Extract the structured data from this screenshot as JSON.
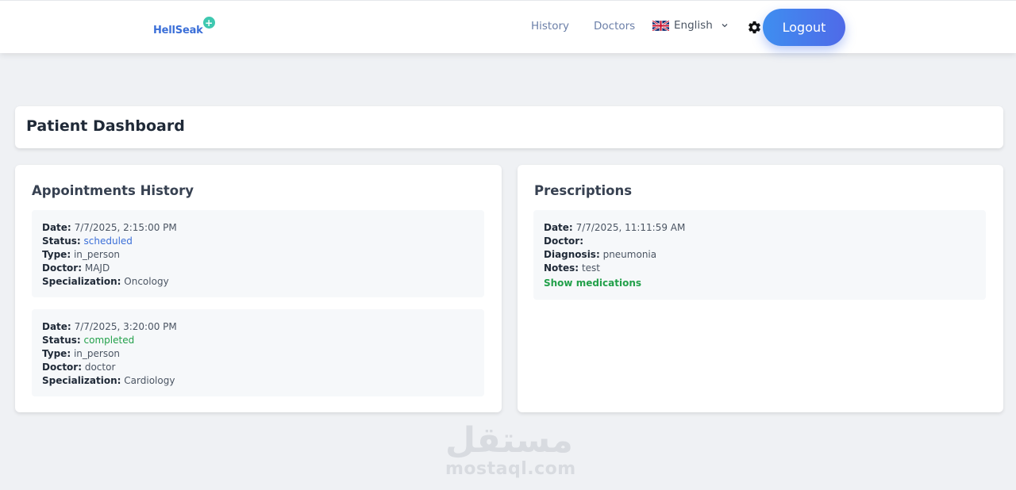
{
  "brand": {
    "name": "HellSeak",
    "plus": "+"
  },
  "nav": {
    "history": "History",
    "doctors": "Doctors",
    "language": "English",
    "logout": "Logout"
  },
  "page": {
    "title": "Patient Dashboard"
  },
  "appointments": {
    "title": "Appointments History",
    "labels": {
      "date": "Date:",
      "status": "Status:",
      "type": "Type:",
      "doctor": "Doctor:",
      "specialization": "Specialization:"
    },
    "items": [
      {
        "date": "7/7/2025, 2:15:00 PM",
        "status": "scheduled",
        "type": "in_person",
        "doctor": "MAJD",
        "specialization": "Oncology"
      },
      {
        "date": "7/7/2025, 3:20:00 PM",
        "status": "completed",
        "type": "in_person",
        "doctor": "doctor",
        "specialization": "Cardiology"
      }
    ]
  },
  "prescriptions": {
    "title": "Prescriptions",
    "labels": {
      "date": "Date:",
      "doctor": "Doctor:",
      "diagnosis": "Diagnosis:",
      "notes": "Notes:"
    },
    "items": [
      {
        "date": "7/7/2025, 11:11:59 AM",
        "doctor": "",
        "diagnosis": "pneumonia",
        "notes": "test",
        "show_medications": "Show medications"
      }
    ]
  },
  "watermark": {
    "arabic": "مستقل",
    "latin": "mostaql.com"
  },
  "colors": {
    "primary": "#3b6fd8",
    "accent_teal": "#3ec8b0",
    "success": "#22a04a",
    "logout_gradient_start": "#3f8ef0",
    "logout_gradient_end": "#4f6ae8",
    "background": "#eff1f4"
  },
  "icons": {
    "settings": "gear-icon",
    "language_flag": "uk-flag-icon",
    "dropdown": "chevron-down-icon"
  }
}
